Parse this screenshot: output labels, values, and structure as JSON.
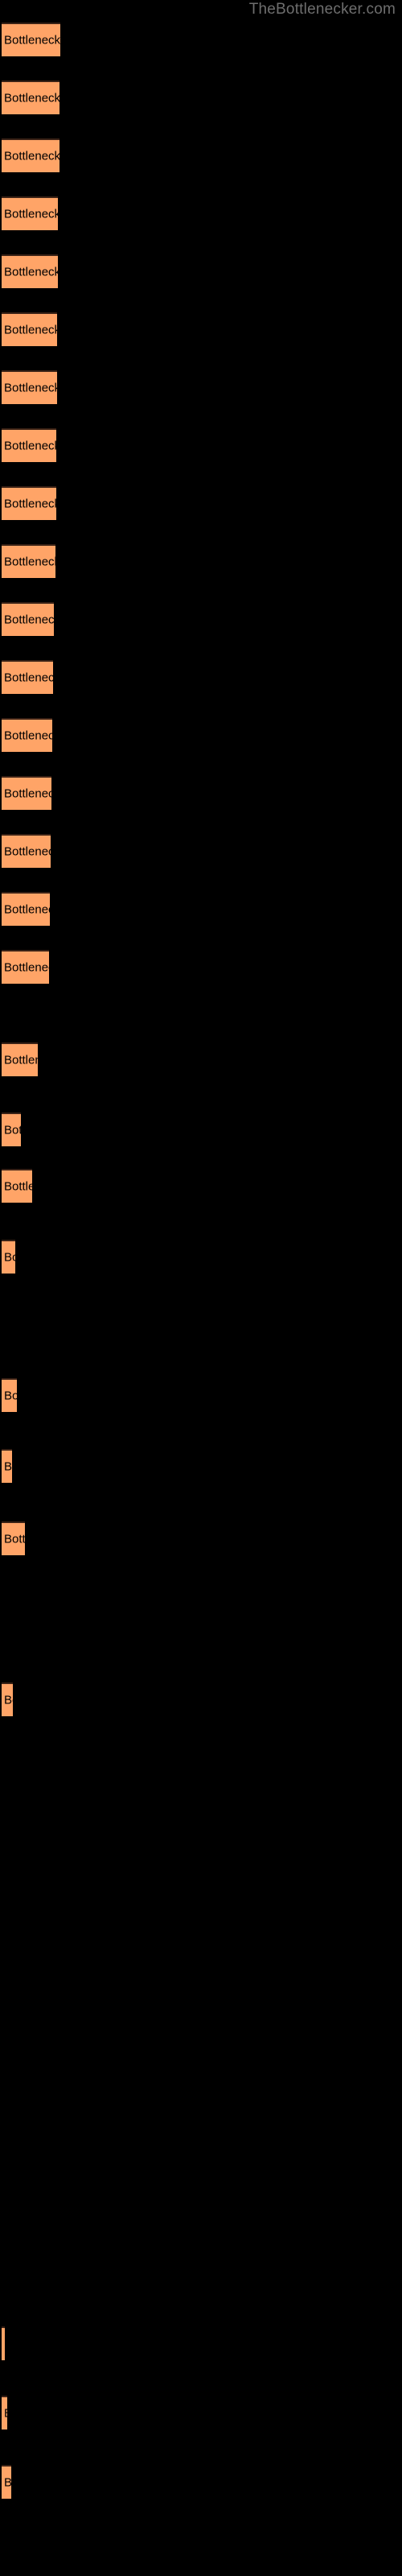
{
  "header": {
    "site_title": "TheBottlenecker.com"
  },
  "colors": {
    "background": "#000000",
    "bar_fill": "#ffa467",
    "bar_border_top": "#3a2216",
    "bar_label_text": "#000000",
    "title_text": "#6e6e6e"
  },
  "chart_data": {
    "type": "bar",
    "orientation": "horizontal",
    "title": "",
    "subtitle": "",
    "xlabel": "",
    "ylabel": "",
    "grid": false,
    "legend": false,
    "bar_label_text": "Bottleneck result",
    "xlim": [
      0,
      74
    ],
    "categories": [
      "Bottleneck result",
      "Bottleneck result",
      "Bottleneck result",
      "Bottleneck result",
      "Bottleneck result",
      "Bottleneck result",
      "Bottleneck result",
      "Bottleneck result",
      "Bottleneck result",
      "Bottleneck result",
      "Bottleneck result",
      "Bottleneck result",
      "Bottleneck result",
      "Bottleneck result",
      "Bottleneck result",
      "Bottleneck result",
      "Bottleneck result",
      "Bottleneck result",
      "Bottleneck result",
      "Bottleneck result",
      "Bottleneck result",
      "Bottleneck result",
      "Bottleneck result",
      "Bottleneck result",
      "Bottleneck result",
      "Bottleneck result",
      "Bottleneck result",
      "Bottleneck result"
    ],
    "bars": [
      {
        "y": 28,
        "width": 73,
        "value": 73
      },
      {
        "y": 100,
        "width": 72,
        "value": 72
      },
      {
        "y": 172,
        "width": 72,
        "value": 72
      },
      {
        "y": 244,
        "width": 70,
        "value": 70
      },
      {
        "y": 316,
        "width": 70,
        "value": 70
      },
      {
        "y": 388,
        "width": 69,
        "value": 69
      },
      {
        "y": 460,
        "width": 69,
        "value": 69
      },
      {
        "y": 532,
        "width": 68,
        "value": 68
      },
      {
        "y": 604,
        "width": 68,
        "value": 68
      },
      {
        "y": 676,
        "width": 67,
        "value": 67
      },
      {
        "y": 748,
        "width": 65,
        "value": 65
      },
      {
        "y": 820,
        "width": 64,
        "value": 64
      },
      {
        "y": 892,
        "width": 63,
        "value": 63
      },
      {
        "y": 964,
        "width": 62,
        "value": 62
      },
      {
        "y": 1036,
        "width": 61,
        "value": 61
      },
      {
        "y": 1108,
        "width": 60,
        "value": 60
      },
      {
        "y": 1180,
        "width": 59,
        "value": 59
      },
      {
        "y": 1295,
        "width": 45,
        "value": 45
      },
      {
        "y": 1382,
        "width": 24,
        "value": 24
      },
      {
        "y": 1452,
        "width": 38,
        "value": 38
      },
      {
        "y": 1540,
        "width": 17,
        "value": 17
      },
      {
        "y": 1712,
        "width": 19,
        "value": 19
      },
      {
        "y": 1800,
        "width": 13,
        "value": 13
      },
      {
        "y": 1890,
        "width": 29,
        "value": 29
      },
      {
        "y": 2090,
        "width": 14,
        "value": 14
      },
      {
        "y": 2890,
        "width": 4,
        "value": 4
      },
      {
        "y": 2976,
        "width": 7,
        "value": 7
      },
      {
        "y": 3062,
        "width": 12,
        "value": 12
      }
    ]
  }
}
